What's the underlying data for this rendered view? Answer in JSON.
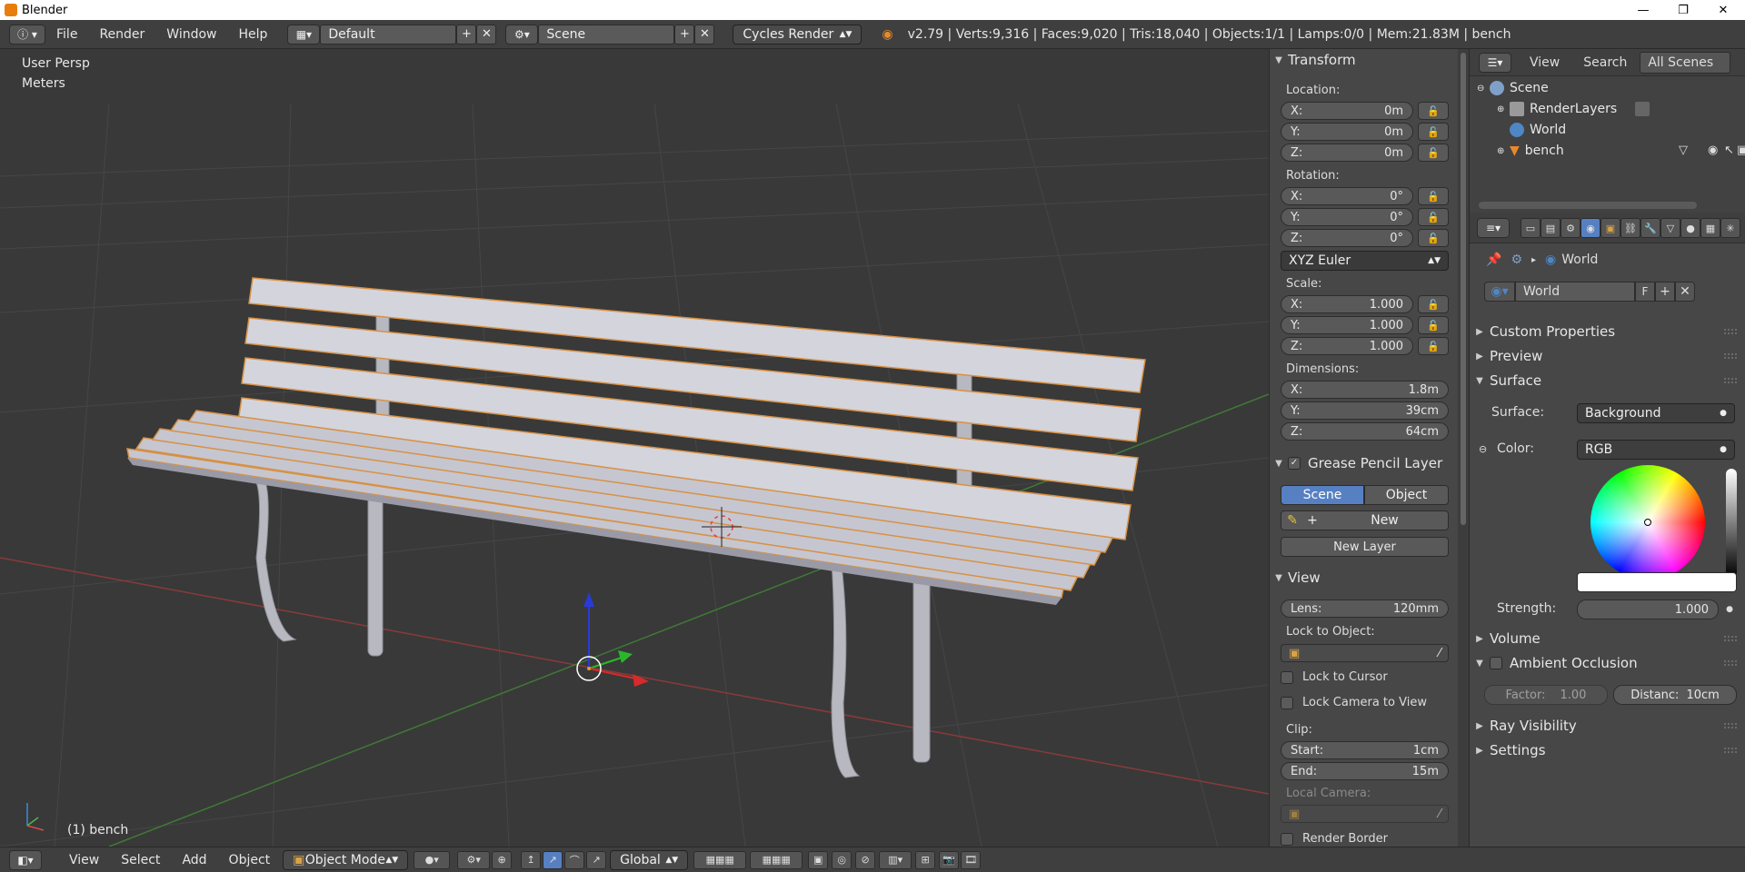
{
  "window": {
    "title": "Blender",
    "minimize": "—",
    "maximize": "❐",
    "close": "✕"
  },
  "topbar": {
    "menus": [
      "File",
      "Render",
      "Window",
      "Help"
    ],
    "layout_value": "Default",
    "scene_value": "Scene",
    "engine": "Cycles Render",
    "stats": "v2.79 | Verts:9,316 | Faces:9,020 | Tris:18,040 | Objects:1/1 | Lamps:0/0 | Mem:21.83M | bench"
  },
  "viewport": {
    "view_name": "User Persp",
    "units": "Meters",
    "active_object": "(1) bench"
  },
  "npanel": {
    "transform": {
      "title": "Transform",
      "location_label": "Location:",
      "location": [
        {
          "k": "X:",
          "v": "0m"
        },
        {
          "k": "Y:",
          "v": "0m"
        },
        {
          "k": "Z:",
          "v": "0m"
        }
      ],
      "rotation_label": "Rotation:",
      "rotation": [
        {
          "k": "X:",
          "v": "0°"
        },
        {
          "k": "Y:",
          "v": "0°"
        },
        {
          "k": "Z:",
          "v": "0°"
        }
      ],
      "rotation_mode": "XYZ Euler",
      "scale_label": "Scale:",
      "scale": [
        {
          "k": "X:",
          "v": "1.000"
        },
        {
          "k": "Y:",
          "v": "1.000"
        },
        {
          "k": "Z:",
          "v": "1.000"
        }
      ],
      "dimensions_label": "Dimensions:",
      "dimensions": [
        {
          "k": "X:",
          "v": "1.8m"
        },
        {
          "k": "Y:",
          "v": "39cm"
        },
        {
          "k": "Z:",
          "v": "64cm"
        }
      ]
    },
    "grease": {
      "title": "Grease Pencil Layer",
      "scene_tab": "Scene",
      "object_tab": "Object",
      "new_label": "New",
      "new_layer": "New Layer"
    },
    "view": {
      "title": "View",
      "lens_label": "Lens:",
      "lens_value": "120mm",
      "lock_to_object": "Lock to Object:",
      "lock_to_cursor": "Lock to Cursor",
      "lock_camera": "Lock Camera to View",
      "clip_label": "Clip:",
      "clip_start_label": "Start:",
      "clip_start": "1cm",
      "clip_end_label": "End:",
      "clip_end": "15m",
      "local_camera": "Local Camera:",
      "render_border": "Render Border"
    }
  },
  "outliner": {
    "view": "View",
    "search": "Search",
    "filter": "All Scenes",
    "items": [
      {
        "label": "Scene"
      },
      {
        "label": "RenderLayers"
      },
      {
        "label": "World"
      },
      {
        "label": "bench"
      }
    ]
  },
  "properties": {
    "breadcrumb": "World",
    "world_name": "World",
    "fake_user": "F",
    "panels": {
      "custom_props": "Custom Properties",
      "preview": "Preview",
      "surface": "Surface",
      "volume": "Volume",
      "ambient_occlusion": "Ambient Occlusion",
      "ray_visibility": "Ray Visibility",
      "settings": "Settings"
    },
    "surface_label": "Surface:",
    "surface_value": "Background",
    "color_label": "Color:",
    "color_value": "RGB",
    "strength_label": "Strength:",
    "strength_value": "1.000",
    "ao_factor_label": "Factor:",
    "ao_factor": "1.00",
    "ao_distance_label": "Distanc:",
    "ao_distance": "10cm"
  },
  "bottombar": {
    "menus": [
      "View",
      "Select",
      "Add",
      "Object"
    ],
    "mode": "Object Mode",
    "orientation": "Global"
  }
}
